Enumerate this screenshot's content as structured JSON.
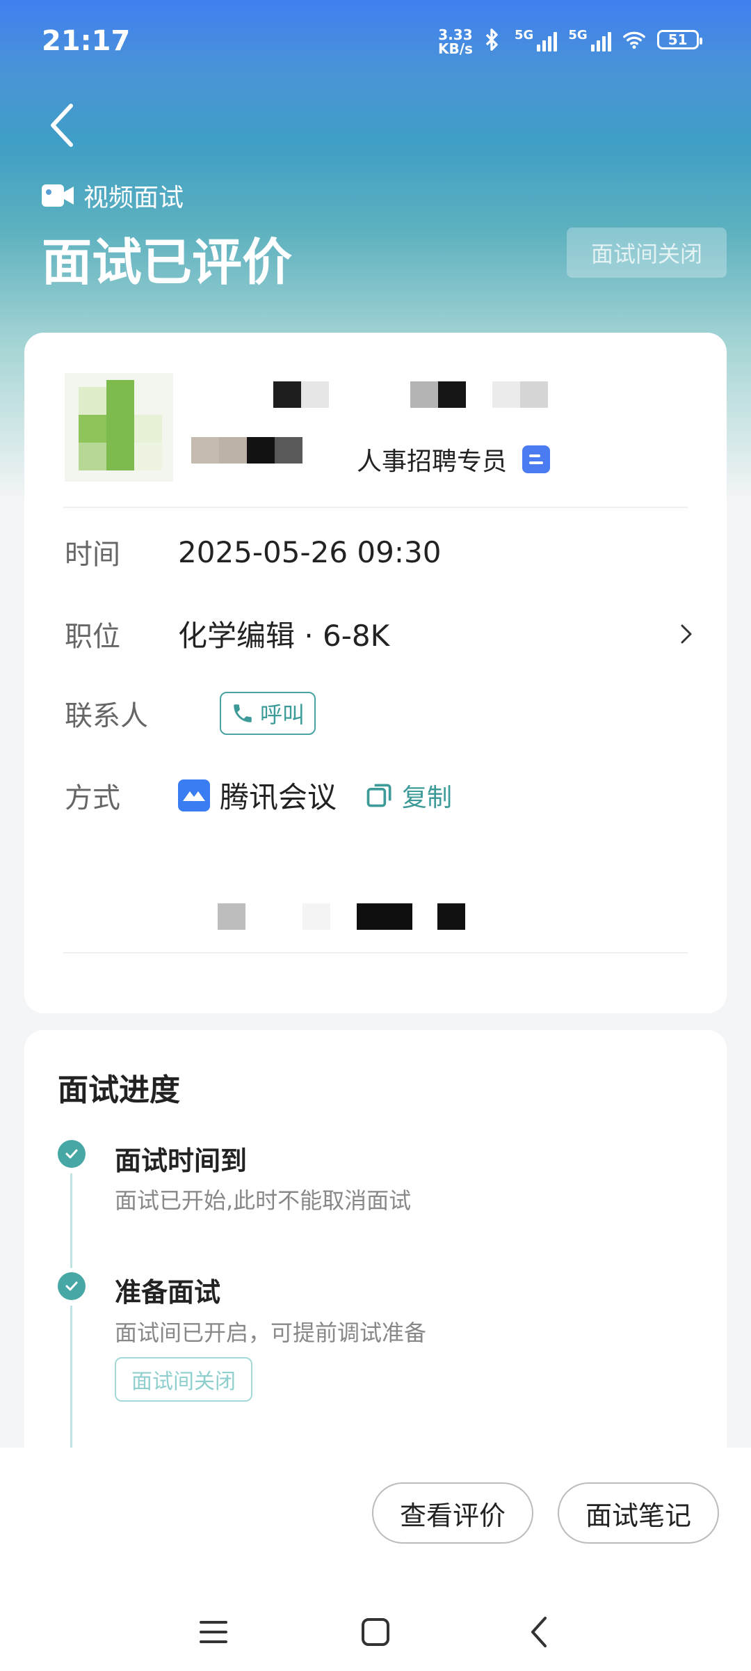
{
  "status_bar": {
    "time": "21:17",
    "net_speed_value": "3.33",
    "net_speed_unit": "KB/s",
    "sim1_label": "5G",
    "sim2_label": "5G",
    "battery": "51"
  },
  "header": {
    "tag": "视频面试",
    "title": "面试已评价",
    "room_button": "面试间关闭"
  },
  "interview_card": {
    "role": "人事招聘专员",
    "time_label": "时间",
    "time_value": "2025-05-26 09:30",
    "position_label": "职位",
    "position_value": "化学编辑 · 6-8K",
    "contact_label": "联系人",
    "call_button": "呼叫",
    "method_label": "方式",
    "method_value": "腾讯会议",
    "copy_button": "复制"
  },
  "progress": {
    "title": "面试进度",
    "steps": [
      {
        "title": "面试时间到",
        "desc": "面试已开始,此时不能取消面试"
      },
      {
        "title": "准备面试",
        "desc": "面试间已开启，可提前调试准备",
        "tag": "面试间关闭"
      }
    ]
  },
  "actions": {
    "view_review": "查看评价",
    "notes": "面试笔记"
  },
  "colors": {
    "accent": "#46a7a5",
    "header_top": "#3f7ff0",
    "header_mid": "#3f9ec6"
  }
}
